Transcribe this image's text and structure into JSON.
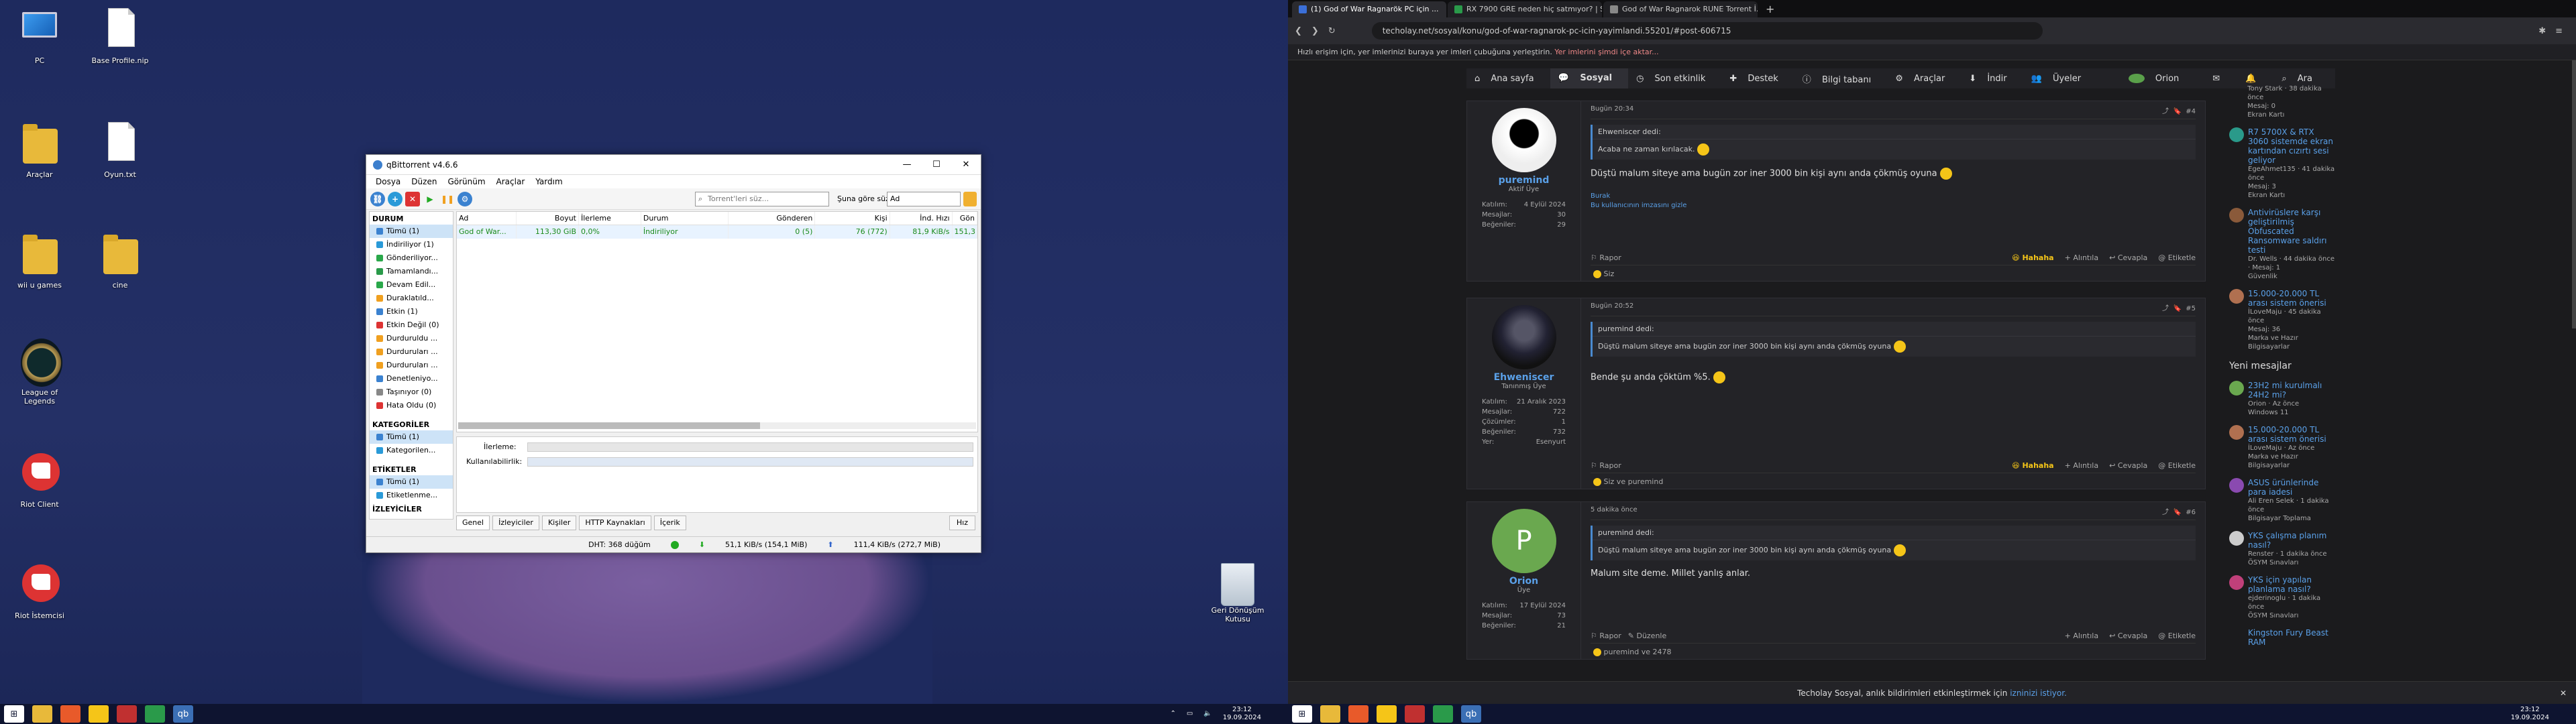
{
  "desktop": {
    "icons": [
      {
        "label": "PC"
      },
      {
        "label": "Base Profile.nip"
      },
      {
        "label": "Araçlar"
      },
      {
        "label": "Oyun.txt"
      },
      {
        "label": "wii u games"
      },
      {
        "label": "cine"
      },
      {
        "label": "League of Legends"
      },
      {
        "label": "Riot Client"
      },
      {
        "label": "Riot İstemcisi"
      }
    ],
    "recycle_label": "Geri Dönüşüm Kutusu"
  },
  "qbt": {
    "title": "qBittorrent v4.6.6",
    "menu": [
      "Dosya",
      "Düzen",
      "Görünüm",
      "Araçlar",
      "Yardım"
    ],
    "search_placeholder": "Torrent'leri süz...",
    "filter_label": "Şuna göre süz:",
    "filter_value": "Ad",
    "sections": {
      "status": {
        "header": "DURUM",
        "items": [
          "Tümü (1)",
          "İndiriliyor (1)",
          "Gönderiliyor...",
          "Tamamlandı...",
          "Devam Edil...",
          "Duraklatıld...",
          "Etkin (1)",
          "Etkin Değil (0)",
          "Durduruldu ...",
          "Durduruları ...",
          "Durduruları ...",
          "Denetleniyo...",
          "Taşınıyor (0)",
          "Hata Oldu (0)"
        ]
      },
      "categories": {
        "header": "KATEGORİLER",
        "items": [
          "Tümü (1)",
          "Kategorilen..."
        ]
      },
      "tags": {
        "header": "ETİKETLER",
        "items": [
          "Tümü (1)",
          "Etiketlenme..."
        ]
      },
      "trackers_header": "İZLEYİCİLER"
    },
    "columns": [
      "Ad",
      "Boyut",
      "İlerleme",
      "Durum",
      "Gönderen",
      "Kişi",
      "İnd. Hızı",
      "Gön"
    ],
    "rows": [
      {
        "name": "God of War...",
        "size": "113,30 GiB",
        "progress": "0,0%",
        "status": "İndiriliyor",
        "seeds": "0 (5)",
        "peers": "76 (772)",
        "speed": "81,9 KiB/s",
        "up": "151,3"
      }
    ],
    "detail_labels": {
      "progress": "İlerleme:",
      "availability": "Kullanılabilirlik:"
    },
    "tabs": [
      "Genel",
      "İzleyiciler",
      "Kişiler",
      "HTTP Kaynakları",
      "İçerik"
    ],
    "speed_button": "Hız",
    "status": {
      "dht": "DHT: 368 düğüm",
      "down": "51,1 KiB/s (154,1 MiB)",
      "up": "111,4 KiB/s (272,7 MiB)"
    }
  },
  "taskbar_left": {
    "time": "23:12",
    "date": "19.09.2024"
  },
  "taskbar_right": {
    "time": "23:12",
    "date": "19.09.2024"
  },
  "browser": {
    "tabs": [
      "(1) God of War Ragnarök PC için ...",
      "RX 7900 GRE neden hiç satmıyor? | S...",
      "God of War Ragnarok RUNE Torrent İ..."
    ],
    "url": "techolay.net/sosyal/konu/god-of-war-ragnarok-pc-icin-yayimlandi.55201/#post-606715",
    "notice_pre": "Hızlı erişim için, yer imlerinizi buraya yer imleri çubuğuna yerleştirin.",
    "notice_link": "Yer imlerini şimdi içe aktar...",
    "nav": [
      "Ana sayfa",
      "Sosyal",
      "Son etkinlik",
      "Destek",
      "Bilgi tabanı",
      "Araçlar",
      "İndir",
      "Üyeler"
    ],
    "nav_user": "Orion",
    "nav_search": "Ara",
    "posts": [
      {
        "time": "Bugün 20:34",
        "num": "#4",
        "user": "puremind",
        "role": "Aktif Üye",
        "stats": [
          [
            "Katılım:",
            "4 Eylül 2024"
          ],
          [
            "Mesajlar:",
            "30"
          ],
          [
            "Beğeniler:",
            "29"
          ]
        ],
        "quote_head": "Ehweniscer dedi:",
        "quote": "Acaba ne zaman kırılacak.",
        "text": "Düştü malum siteye ama bugün zor iner 3000 bin kişi aynı anda çökmüş oyuna",
        "sig1": "Burak",
        "sig2": "Bu kullanıcının imzasını gizle",
        "reacts": "Siz"
      },
      {
        "time": "Bugün 20:52",
        "num": "#5",
        "user": "Ehweniscer",
        "role": "Tanınmış Üye",
        "stats": [
          [
            "Katılım:",
            "21 Aralık 2023"
          ],
          [
            "Mesajlar:",
            "722"
          ],
          [
            "Çözümler:",
            "1"
          ],
          [
            "Beğeniler:",
            "732"
          ],
          [
            "Yer:",
            "Esenyurt"
          ]
        ],
        "quote_head": "puremind dedi:",
        "quote": "Düştü malum siteye ama bugün zor iner 3000 bin kişi aynı anda çökmüş oyuna",
        "text": "Bende şu anda çöktüm %5.",
        "reacts": "Siz ve puremind"
      },
      {
        "time": "5 dakika önce",
        "num": "#6",
        "user": "Orion",
        "role": "Üye",
        "stats": [
          [
            "Katılım:",
            "17 Eylül 2024"
          ],
          [
            "Mesajlar:",
            "73"
          ],
          [
            "Beğeniler:",
            "21"
          ]
        ],
        "quote_head": "puremind dedi:",
        "quote": "Düştü malum siteye ama bugün zor iner 3000 bin kişi aynı anda çökmüş oyuna",
        "text": "Malum site deme. Millet yanlış anlar.",
        "reacts": "puremind ve 2478"
      }
    ],
    "actions": {
      "report": "Rapor",
      "edit": "Düzenle",
      "haha": "Hahaha",
      "quote": "Alıntıla",
      "reply": "Cevapla",
      "tag": "Etiketle"
    },
    "sidebar_top": [
      {
        "title": "",
        "meta1": "Tony Stark · 38 dakika önce",
        "meta2": "Mesaj: 0",
        "meta3": "Ekran Kartı"
      },
      {
        "title": "R7 5700X & RTX 3060 sistemde ekran kartından cızırtı sesi geliyor",
        "meta1": "EgeAhmet135 · 41 dakika önce",
        "meta2": "Mesaj: 3",
        "meta3": "Ekran Kartı"
      },
      {
        "title": "Antivirüslere karşı geliştirilmiş Obfuscated Ransomware saldırı testi",
        "meta1": "Dr. Wells · 44 dakika önce · Mesaj: 1",
        "meta2": "Güvenlik",
        "meta3": ""
      },
      {
        "title": "15.000-20.000 TL arası sistem önerisi",
        "meta1": "İLoveMaju · 45 dakika önce",
        "meta2": "Mesaj: 36",
        "meta3": "Marka ve Hazır Bilgisayarlar"
      }
    ],
    "sidebar_header": "Yeni mesajlar",
    "sidebar_new": [
      {
        "title": "23H2 mi kurulmalı 24H2 mi?",
        "meta1": "Orion · Az önce",
        "meta2": "Windows 11"
      },
      {
        "title": "15.000-20.000 TL arası sistem önerisi",
        "meta1": "İLoveMaju · Az önce",
        "meta2": "Marka ve Hazır Bilgisayarlar"
      },
      {
        "title": "ASUS ürünlerinde para iadesi",
        "meta1": "Ali Eren Selek · 1 dakika önce",
        "meta2": "Bilgisayar Toplama"
      },
      {
        "title": "YKS çalışma planım nasıl?",
        "meta1": "Renster · 1 dakika önce",
        "meta2": "ÖSYM Sınavları"
      },
      {
        "title": "YKS için yapılan planlama nasıl?",
        "meta1": "ejderinoglu · 1 dakika önce",
        "meta2": "ÖSYM Sınavları"
      }
    ],
    "sidebar_cut": "Kingston Fury Beast RAM",
    "cookie_text": "Techolay Sosyal, anlık bildirimleri etkinleştirmek için",
    "cookie_link": "izninizi istiyor."
  }
}
